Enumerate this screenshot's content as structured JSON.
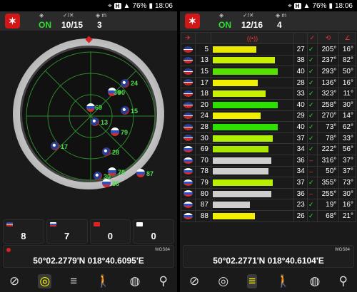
{
  "status_bar": {
    "network": "H",
    "battery": "76%",
    "time": "18:06"
  },
  "left": {
    "fix_status": "ON",
    "sats_used": "10/15",
    "altitude_value": "3",
    "radar": {
      "compass_label": "N",
      "labels": [
        "24",
        "30",
        "90",
        "69",
        "15",
        "13",
        "79",
        "70",
        "80",
        "28",
        "17",
        "78",
        "87",
        "88",
        "13",
        "18",
        "30"
      ]
    },
    "counts": [
      {
        "flag": "us",
        "value": "8"
      },
      {
        "flag": "ru",
        "value": "7"
      },
      {
        "flag": "cn",
        "value": "0"
      },
      {
        "flag": "jp",
        "value": "0"
      }
    ],
    "coords": "50°02.2779'N  018°40.6095'E",
    "datum": "WGS84"
  },
  "right": {
    "fix_status": "ON",
    "sats_used": "12/16",
    "altitude_value": "4",
    "table": {
      "rows": [
        {
          "flag": "us",
          "prn": "5",
          "snr": "27",
          "used": true,
          "az": "205°",
          "el": "16°",
          "color": "#e8e800",
          "pct": 0.55
        },
        {
          "flag": "us",
          "prn": "13",
          "snr": "38",
          "used": true,
          "az": "237°",
          "el": "82°",
          "color": "#c8f000",
          "pct": 0.78
        },
        {
          "flag": "us",
          "prn": "15",
          "snr": "40",
          "used": true,
          "az": "293°",
          "el": "50°",
          "color": "#5ae000",
          "pct": 0.82
        },
        {
          "flag": "us",
          "prn": "17",
          "snr": "28",
          "used": true,
          "az": "136°",
          "el": "16°",
          "color": "#f0f000",
          "pct": 0.57
        },
        {
          "flag": "us",
          "prn": "18",
          "snr": "33",
          "used": true,
          "az": "323°",
          "el": "11°",
          "color": "#c8f000",
          "pct": 0.67
        },
        {
          "flag": "us",
          "prn": "20",
          "snr": "40",
          "used": true,
          "az": "258°",
          "el": "30°",
          "color": "#2ee000",
          "pct": 0.82
        },
        {
          "flag": "us",
          "prn": "24",
          "snr": "29",
          "used": true,
          "az": "270°",
          "el": "14°",
          "color": "#f0f000",
          "pct": 0.6
        },
        {
          "flag": "us",
          "prn": "28",
          "snr": "40",
          "used": true,
          "az": "73°",
          "el": "62°",
          "color": "#2ee000",
          "pct": 0.82
        },
        {
          "flag": "us",
          "prn": "30",
          "snr": "37",
          "used": true,
          "az": "78°",
          "el": "33°",
          "color": "#b0f000",
          "pct": 0.76
        },
        {
          "flag": "ru",
          "prn": "69",
          "snr": "34",
          "used": true,
          "az": "222°",
          "el": "56°",
          "color": "#a8e800",
          "pct": 0.7
        },
        {
          "flag": "ru",
          "prn": "70",
          "snr": "36",
          "used": false,
          "az": "316°",
          "el": "37°",
          "color": "#cfcfcf",
          "pct": 0.74
        },
        {
          "flag": "ru",
          "prn": "78",
          "snr": "34",
          "used": false,
          "az": "50°",
          "el": "37°",
          "color": "#cfcfcf",
          "pct": 0.7
        },
        {
          "flag": "ru",
          "prn": "79",
          "snr": "37",
          "used": true,
          "az": "355°",
          "el": "73°",
          "color": "#b8f000",
          "pct": 0.76
        },
        {
          "flag": "ru",
          "prn": "80",
          "snr": "36",
          "used": false,
          "az": "255°",
          "el": "30°",
          "color": "#cfcfcf",
          "pct": 0.74
        },
        {
          "flag": "ru",
          "prn": "87",
          "snr": "23",
          "used": true,
          "az": "19°",
          "el": "16°",
          "color": "#cfcfcf",
          "pct": 0.47
        },
        {
          "flag": "ru",
          "prn": "88",
          "snr": "26",
          "used": true,
          "az": "68°",
          "el": "21°",
          "color": "#f0f000",
          "pct": 0.53
        }
      ]
    },
    "coords": "50°02.2771'N  018°40.6104'E",
    "datum": "WGS84"
  },
  "bottom_nav": [
    "compass-icon",
    "radar-icon",
    "signal-bars-icon",
    "walk-icon",
    "globe-icon",
    "location-pin-icon"
  ]
}
